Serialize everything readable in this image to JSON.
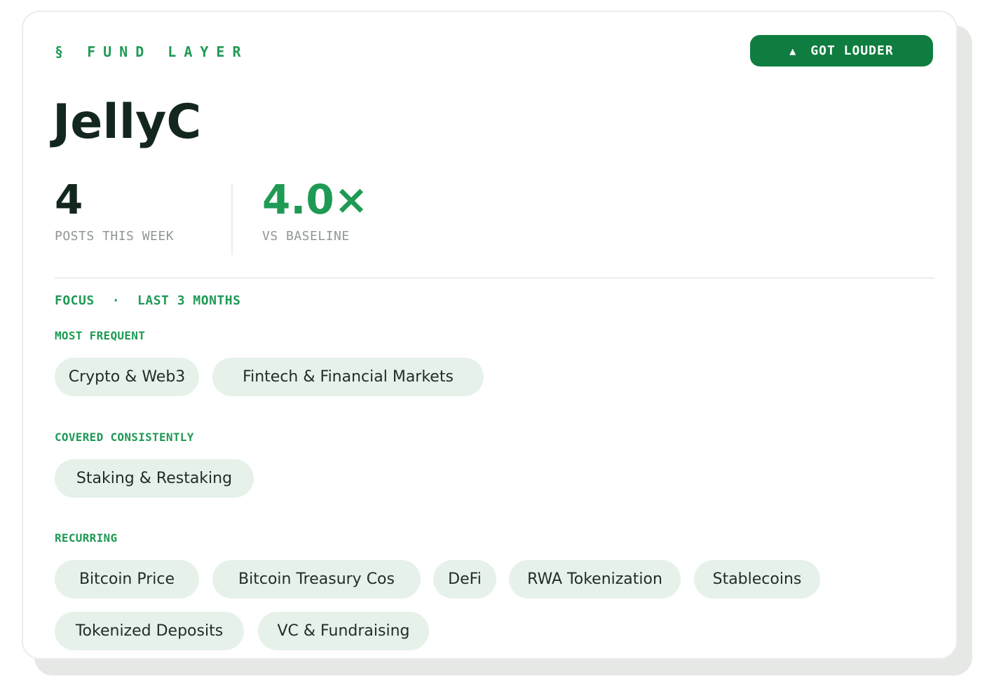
{
  "header": {
    "eyebrow": "§ FUND LAYER",
    "badge": {
      "icon": "triangle-up-icon",
      "label": "GOT LOUDER"
    }
  },
  "title": "JellyC",
  "stats": {
    "posts": {
      "value": "4",
      "label": "POSTS THIS WEEK"
    },
    "ratio": {
      "value": "4.0×",
      "label": "VS BASELINE"
    }
  },
  "focus": {
    "label": "FOCUS",
    "separator": "·",
    "period": "LAST 3 MONTHS"
  },
  "sections": {
    "most_frequent": {
      "label": "MOST FREQUENT",
      "tags": [
        "Crypto & Web3",
        "Fintech & Financial Markets"
      ]
    },
    "covered_consistently": {
      "label": "COVERED CONSISTENTLY",
      "tags": [
        "Staking & Restaking"
      ]
    },
    "recurring": {
      "label": "RECURRING",
      "tags": [
        "Bitcoin Price",
        "Bitcoin Treasury Cos",
        "DeFi",
        "RWA Tokenization",
        "Stablecoins",
        "Tokenized Deposits",
        "VC & Fundraising"
      ]
    }
  },
  "colors": {
    "accent": "#1f9a55",
    "badge_bg": "#0f7d3f",
    "title": "#14271e",
    "muted": "#8f9793",
    "pill_bg": "#e6f1ea"
  }
}
